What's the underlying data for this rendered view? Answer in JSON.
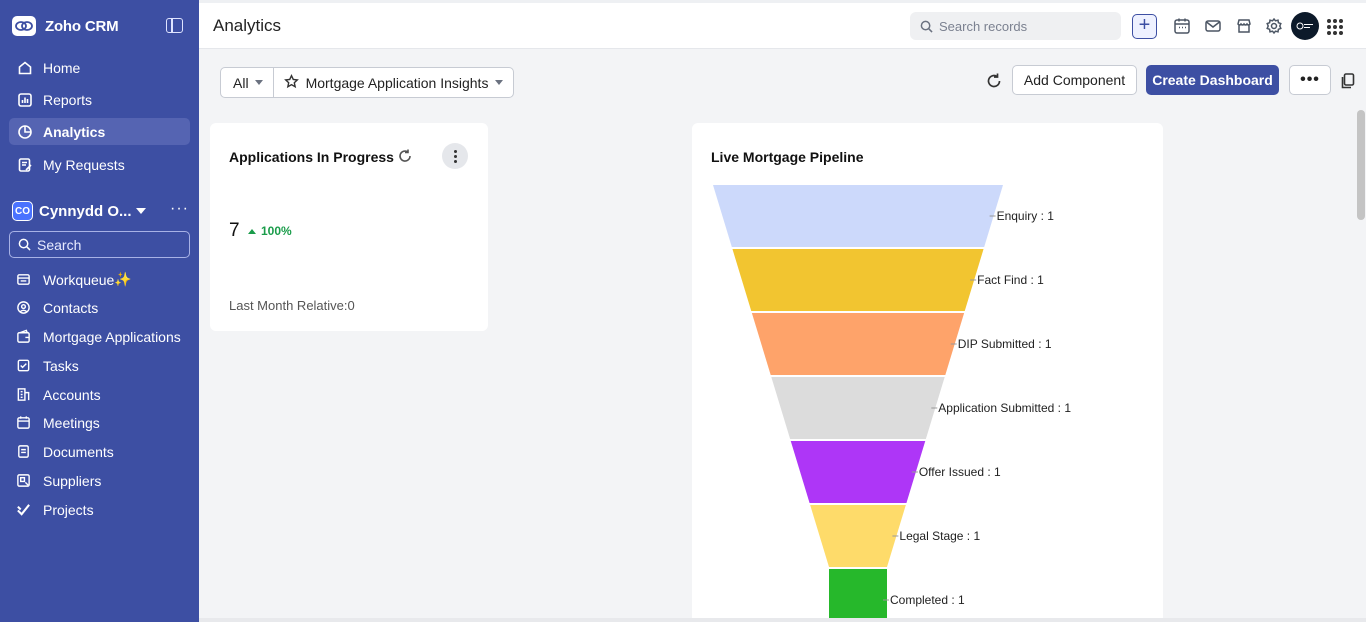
{
  "app": {
    "name": "Zoho CRM"
  },
  "nav": [
    {
      "label": "Home",
      "icon": "home-icon"
    },
    {
      "label": "Reports",
      "icon": "reports-icon"
    },
    {
      "label": "Analytics",
      "icon": "analytics-icon",
      "active": true
    },
    {
      "label": "My Requests",
      "icon": "requests-icon"
    }
  ],
  "org": {
    "badge": "CO",
    "name": "Cynnydd O..."
  },
  "sidebar_search": {
    "placeholder": "Search"
  },
  "modules": [
    {
      "label": "Workqueue",
      "icon": "workqueue-icon"
    },
    {
      "label": "Contacts",
      "icon": "contacts-icon"
    },
    {
      "label": "Mortgage Applications",
      "icon": "wallet-icon"
    },
    {
      "label": "Tasks",
      "icon": "tasks-icon"
    },
    {
      "label": "Accounts",
      "icon": "accounts-icon"
    },
    {
      "label": "Meetings",
      "icon": "meetings-icon"
    },
    {
      "label": "Documents",
      "icon": "documents-icon"
    },
    {
      "label": "Suppliers",
      "icon": "suppliers-icon"
    },
    {
      "label": "Projects",
      "icon": "projects-icon"
    }
  ],
  "header": {
    "title": "Analytics",
    "search_placeholder": "Search records",
    "plus": "+"
  },
  "toolbar": {
    "filter_all": "All",
    "dashboard_name": "Mortgage Application Insights",
    "add_component": "Add Component",
    "create_dashboard": "Create Dashboard",
    "more": "•••"
  },
  "kpi_widget": {
    "title": "Applications In Progress",
    "value": "7",
    "delta": "100%",
    "footer": "Last Month Relative:0"
  },
  "funnel_widget": {
    "title": "Live Mortgage Pipeline",
    "stages": [
      {
        "label": "Enquiry : 1",
        "color": "#ccd9fb"
      },
      {
        "label": "Fact Find : 1",
        "color": "#f2c530"
      },
      {
        "label": "DIP Submitted : 1",
        "color": "#fea36a"
      },
      {
        "label": "Application Submitted : 1",
        "color": "#dcdcdc"
      },
      {
        "label": "Offer Issued : 1",
        "color": "#ae36f7"
      },
      {
        "label": "Legal Stage : 1",
        "color": "#fedb6a"
      },
      {
        "label": "Completed : 1",
        "color": "#26b82b"
      }
    ]
  },
  "colors": {
    "sidebar": "#3d4fa3",
    "accent": "#3d4fa3",
    "positive": "#1a9c4a"
  }
}
